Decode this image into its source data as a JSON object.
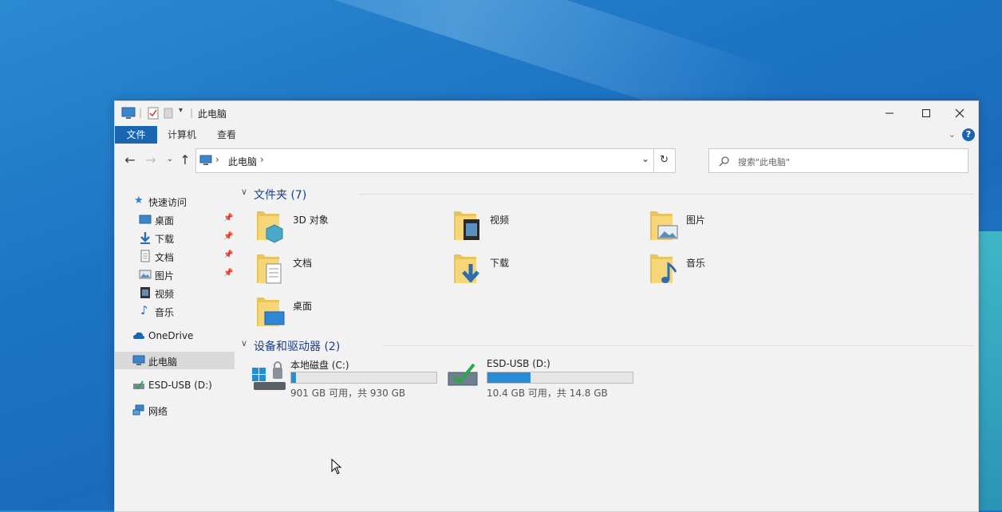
{
  "window": {
    "title": "此电脑"
  },
  "ribbon": {
    "tabs": [
      "文件",
      "计算机",
      "查看"
    ],
    "help": "?"
  },
  "address": {
    "crumb": "此电脑",
    "separator": "›"
  },
  "search": {
    "placeholder": "搜索\"此电脑\""
  },
  "sidebar": {
    "quick_access": "快速访问",
    "quick_items": [
      "桌面",
      "下载",
      "文档",
      "图片",
      "视频",
      "音乐"
    ],
    "onedrive": "OneDrive",
    "this_pc": "此电脑",
    "esd": "ESD-USB (D:)",
    "network": "网络"
  },
  "folders_section": {
    "title": "文件夹 (7)",
    "items": [
      "3D 对象",
      "视频",
      "图片",
      "文档",
      "下载",
      "音乐",
      "桌面"
    ]
  },
  "drives_section": {
    "title": "设备和驱动器 (2)",
    "drives": [
      {
        "name": "本地磁盘 (C:)",
        "free": "901 GB 可用，共 930 GB",
        "used_fraction": 0.031
      },
      {
        "name": "ESD-USB (D:)",
        "free": "10.4 GB 可用，共 14.8 GB",
        "used_fraction": 0.297
      }
    ]
  },
  "colors": {
    "accent": "#1a66b3",
    "folder": "#e8c45a",
    "bar_fill": "#2a8bd6"
  }
}
